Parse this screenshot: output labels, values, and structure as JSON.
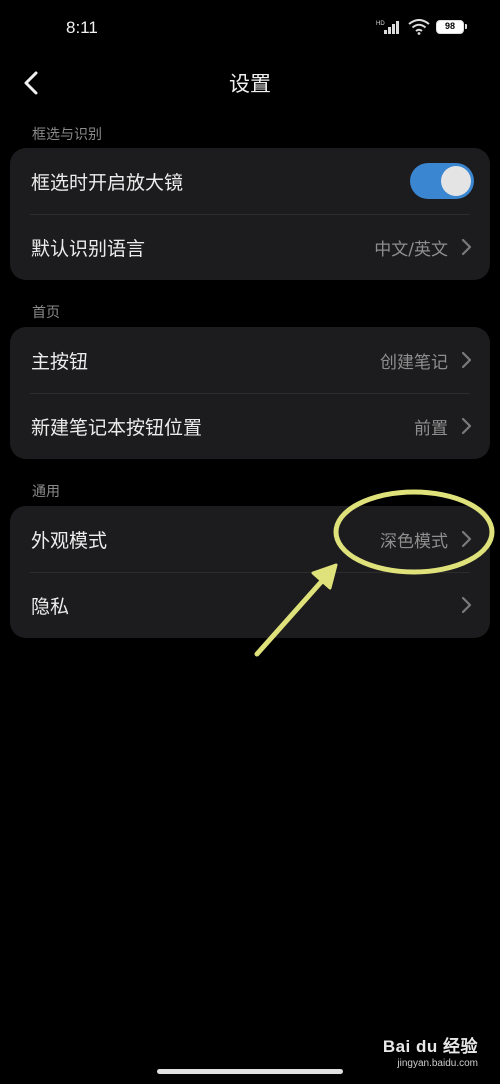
{
  "status_bar": {
    "time": "8:11",
    "network_label": "HD",
    "battery": "98"
  },
  "header": {
    "title": "设置"
  },
  "sections": [
    {
      "label": "框选与识别",
      "rows": [
        {
          "label": "框选时开启放大镜",
          "toggle_on": true
        },
        {
          "label": "默认识别语言",
          "value": "中文/英文"
        }
      ]
    },
    {
      "label": "首页",
      "rows": [
        {
          "label": "主按钮",
          "value": "创建笔记"
        },
        {
          "label": "新建笔记本按钮位置",
          "value": "前置"
        }
      ]
    },
    {
      "label": "通用",
      "rows": [
        {
          "label": "外观模式",
          "value": "深色模式"
        },
        {
          "label": "隐私"
        }
      ]
    }
  ],
  "watermark": {
    "logo": "Bai du 经验",
    "url": "jingyan.baidu.com"
  },
  "colors": {
    "background": "#000000",
    "card": "#1c1c1e",
    "accent_toggle": "#3a86d0",
    "annotation": "#dfe27a"
  }
}
